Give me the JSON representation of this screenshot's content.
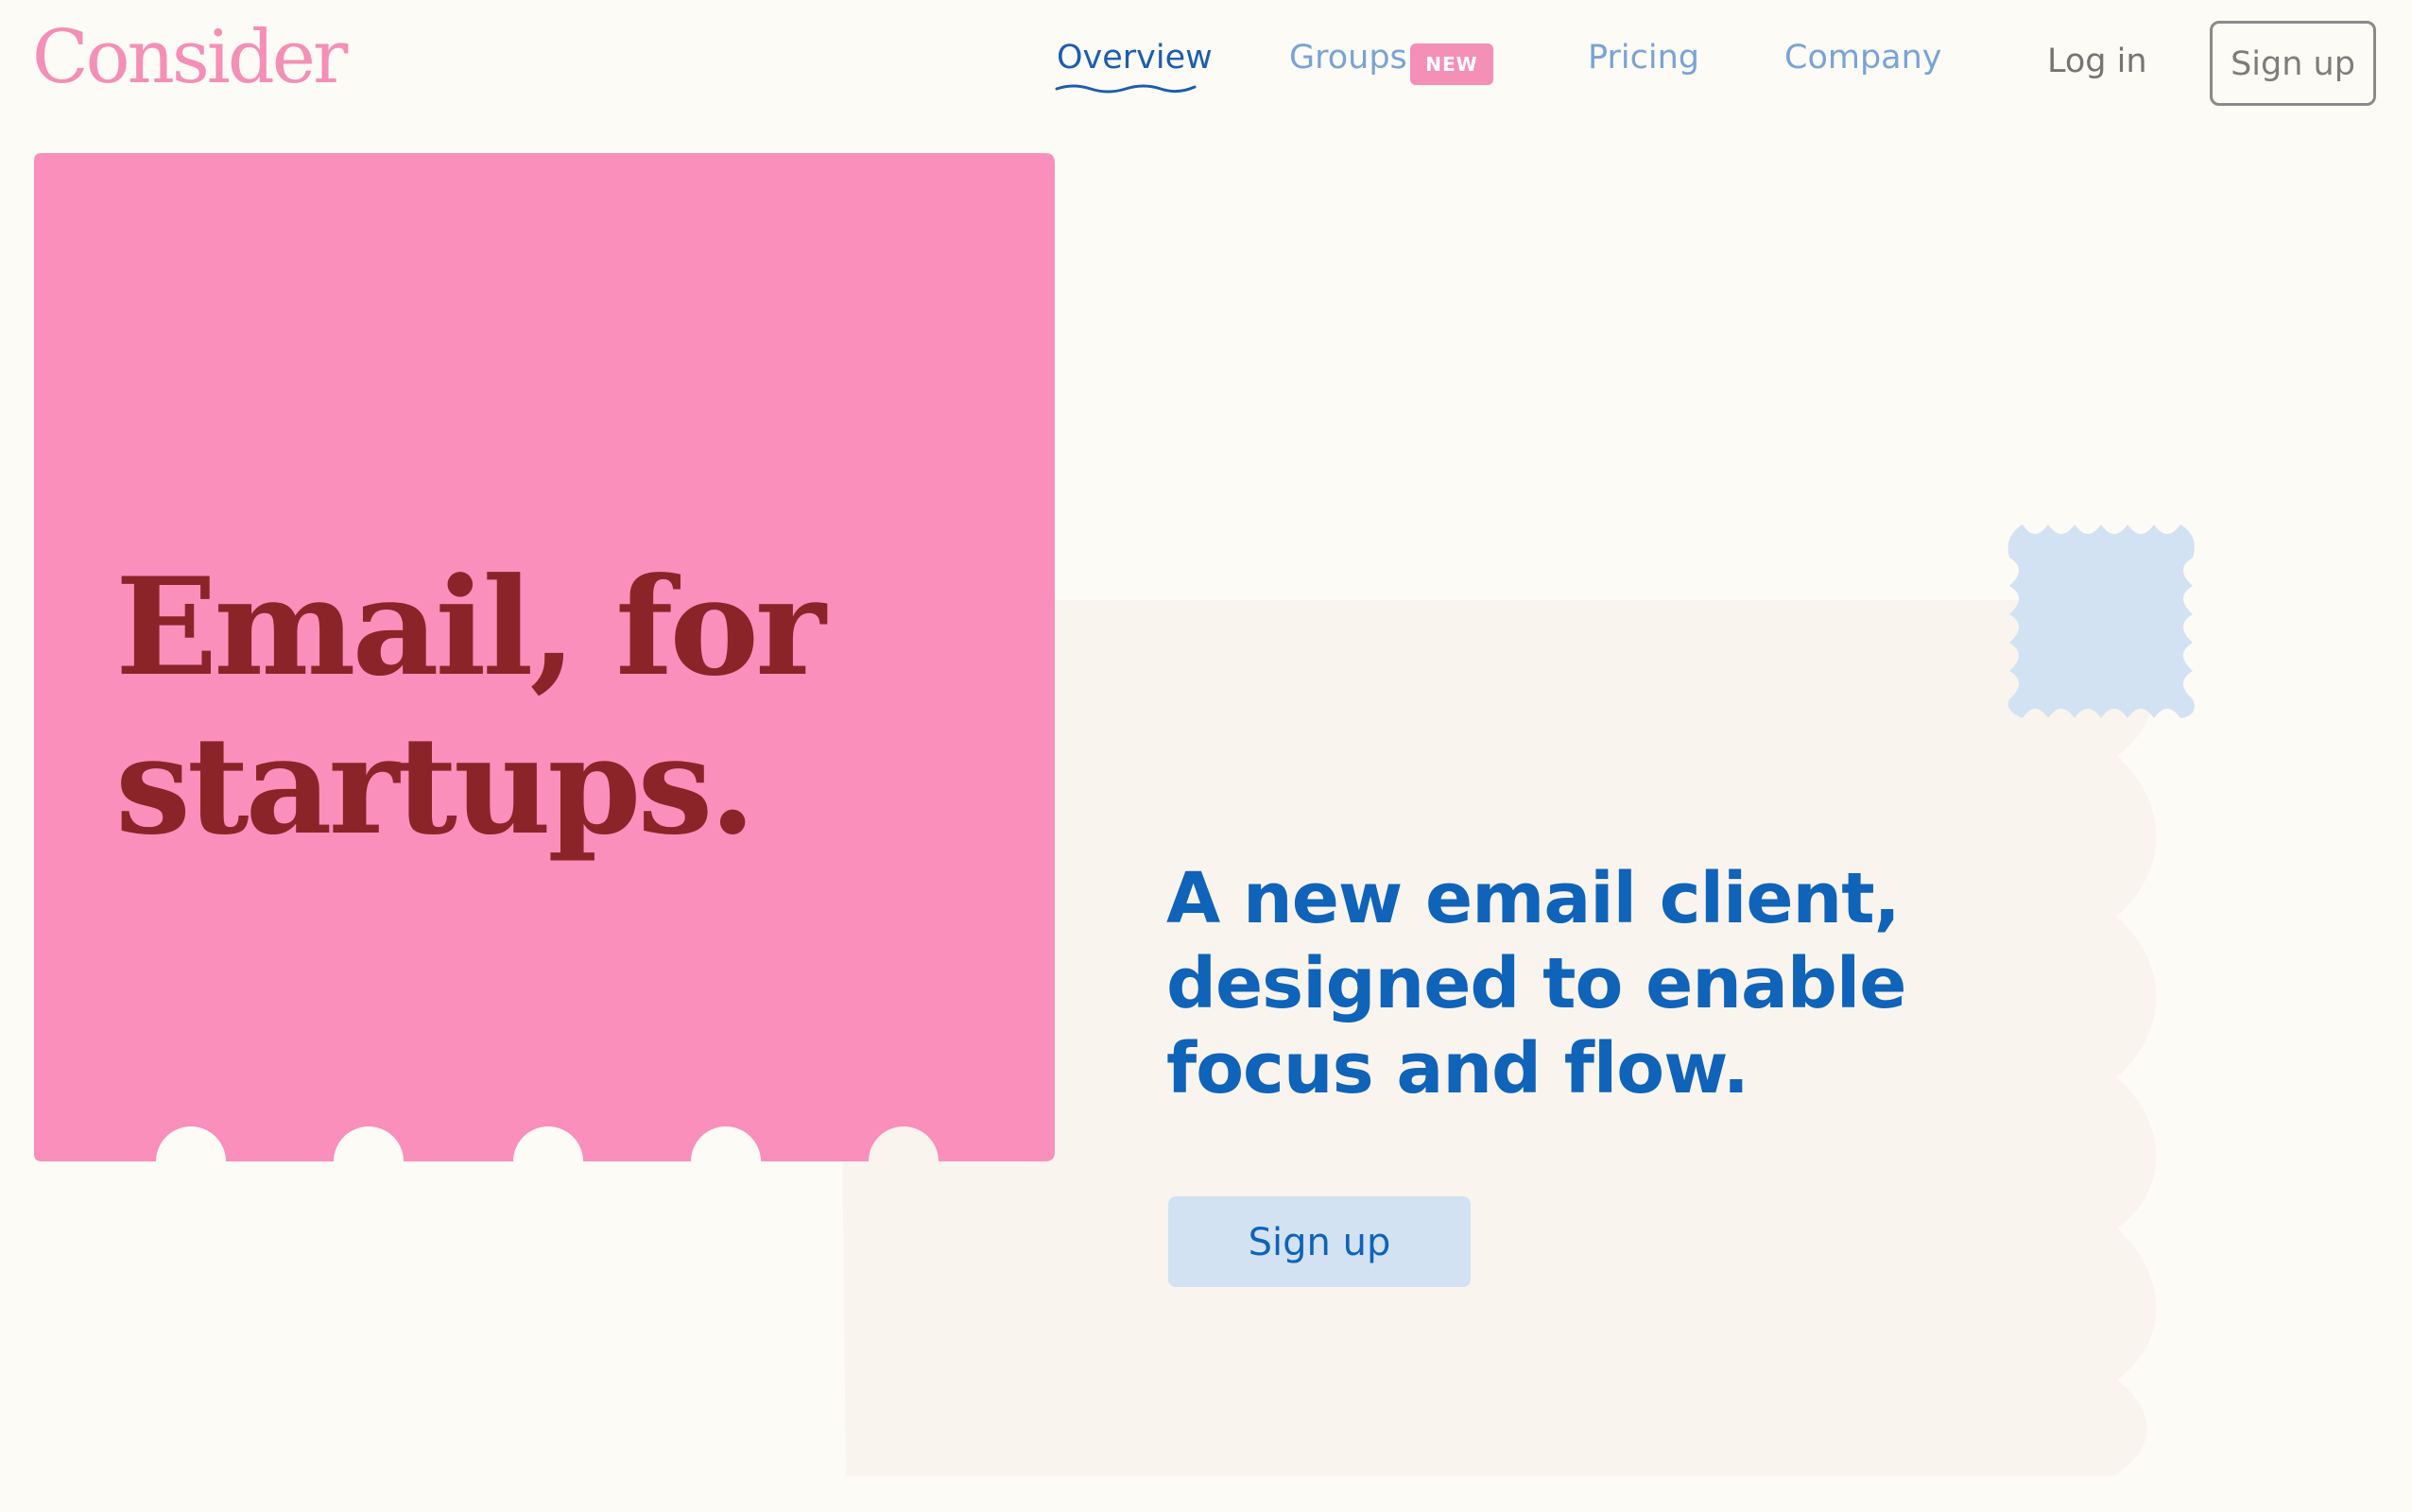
{
  "brand": {
    "logo_text": "Consider"
  },
  "nav": {
    "items": [
      {
        "label": "Overview"
      },
      {
        "label": "Groups",
        "badge": "NEW"
      },
      {
        "label": "Pricing"
      },
      {
        "label": "Company"
      }
    ],
    "active_item": "Overview",
    "login_label": "Log in",
    "signup_label": "Sign up"
  },
  "hero": {
    "title_line1": "Email, for",
    "title_line2": "startups.",
    "subtitle_line1": "A new email client,",
    "subtitle_line2": "designed to enable",
    "subtitle_line3": "focus and flow.",
    "cta_label": "Sign up"
  },
  "colors": {
    "background": "#fdfbf6",
    "brand_pink": "#f48fb6",
    "hero_title": "#8a2429",
    "primary_blue": "#0f63b8",
    "nav_inactive": "#7aa3d6",
    "light_blue": "#d2e2f3",
    "card_bg": "#faf4ee"
  }
}
